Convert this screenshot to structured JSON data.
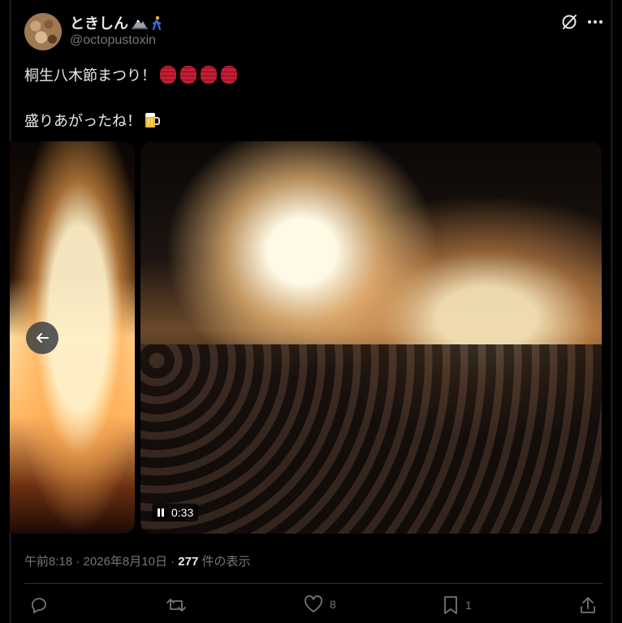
{
  "user": {
    "display_name": "ときしん",
    "handle": "@octopustoxin"
  },
  "tweet": {
    "line1": "桐生八木節まつり！",
    "line2": "盛りあがったね！",
    "line1_emoji": "lantern-emoji x4",
    "line2_emoji": "beer-mug-emoji"
  },
  "media": {
    "duration": "0:33"
  },
  "meta": {
    "time": "午前8:18",
    "sep1": "·",
    "date": "2026年8月10日",
    "sep2": "·",
    "views": "277",
    "views_label": "件の表示"
  },
  "actions": {
    "likes": "8",
    "bookmarks": "1"
  },
  "colors": {
    "background": "#000000",
    "text": "#e7e9ea",
    "muted": "#71767b",
    "divider": "#2f3336"
  }
}
